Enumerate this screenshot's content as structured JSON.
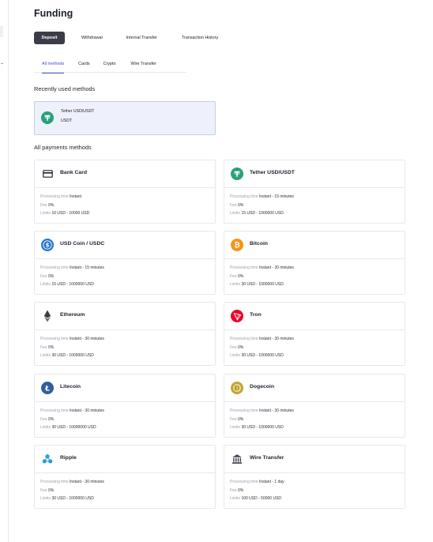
{
  "page": {
    "title": "Funding"
  },
  "top_tabs": [
    {
      "label": "Deposit",
      "active": true
    },
    {
      "label": "Withdrawal",
      "active": false
    },
    {
      "label": "Internal Transfer",
      "active": false
    },
    {
      "label": "Transaction History",
      "active": false
    }
  ],
  "sub_tabs": [
    {
      "label": "All methods",
      "active": true
    },
    {
      "label": "Cards",
      "active": false
    },
    {
      "label": "Crypto",
      "active": false
    },
    {
      "label": "Wire Transfer",
      "active": false
    }
  ],
  "recent": {
    "title": "Recently used methods",
    "item": {
      "name": "Tether USD/USDT",
      "sub": "USDT",
      "icon": "tether-icon"
    }
  },
  "all": {
    "title": "All payments methods",
    "labels": {
      "processing": "Processing time",
      "fee": "Fee",
      "limits": "Limits"
    },
    "methods": [
      {
        "name": "Bank Card",
        "icon": "card-icon",
        "processing": "Instant",
        "fee": "0%",
        "limits": "10 USD - 10000 USD"
      },
      {
        "name": "Tether USD/USDT",
        "icon": "tether-icon",
        "processing": "Instant - 15 minutes",
        "fee": "0%",
        "limits": "15 USD - 1000000 USD"
      },
      {
        "name": "USD Coin / USDC",
        "icon": "usdc-icon",
        "processing": "Instant - 15 minutes",
        "fee": "0%",
        "limits": "15 USD - 1000000 USD"
      },
      {
        "name": "Bitcoin",
        "icon": "bitcoin-icon",
        "processing": "Instant - 30 minutes",
        "fee": "0%",
        "limits": "30 USD - 1000000 USD"
      },
      {
        "name": "Ethereum",
        "icon": "ethereum-icon",
        "processing": "Instant - 30 minutes",
        "fee": "0%",
        "limits": "30 USD - 1000000 USD"
      },
      {
        "name": "Tron",
        "icon": "tron-icon",
        "processing": "Instant - 30 minutes",
        "fee": "0%",
        "limits": "30 USD - 1000000 USD"
      },
      {
        "name": "Litecoin",
        "icon": "litecoin-icon",
        "processing": "Instant - 30 minutes",
        "fee": "0%",
        "limits": "30 USD - 10000000 USD"
      },
      {
        "name": "Dogecoin",
        "icon": "dogecoin-icon",
        "processing": "Instant - 30 minutes",
        "fee": "0%",
        "limits": "30 USD - 1000000 USD"
      },
      {
        "name": "Ripple",
        "icon": "ripple-icon",
        "processing": "Instant - 30 minutes",
        "fee": "0%",
        "limits": "30 USD - 1000000 USD"
      },
      {
        "name": "Wire Transfer",
        "icon": "bank-icon",
        "processing": "Instant - 1 day",
        "fee": "0%",
        "limits": "100 USD - 50000 USD"
      }
    ]
  },
  "colors": {
    "accent": "#3d4fd0",
    "active_tab": "#3a3d47",
    "tether": "#26a17b",
    "usdc": "#2775ca",
    "bitcoin": "#f7931a",
    "ethereum": "#3c3c3d",
    "tron": "#eb0029",
    "litecoin": "#345d9d",
    "dogecoin": "#c2a633",
    "ripple": "#2b9cd8"
  }
}
